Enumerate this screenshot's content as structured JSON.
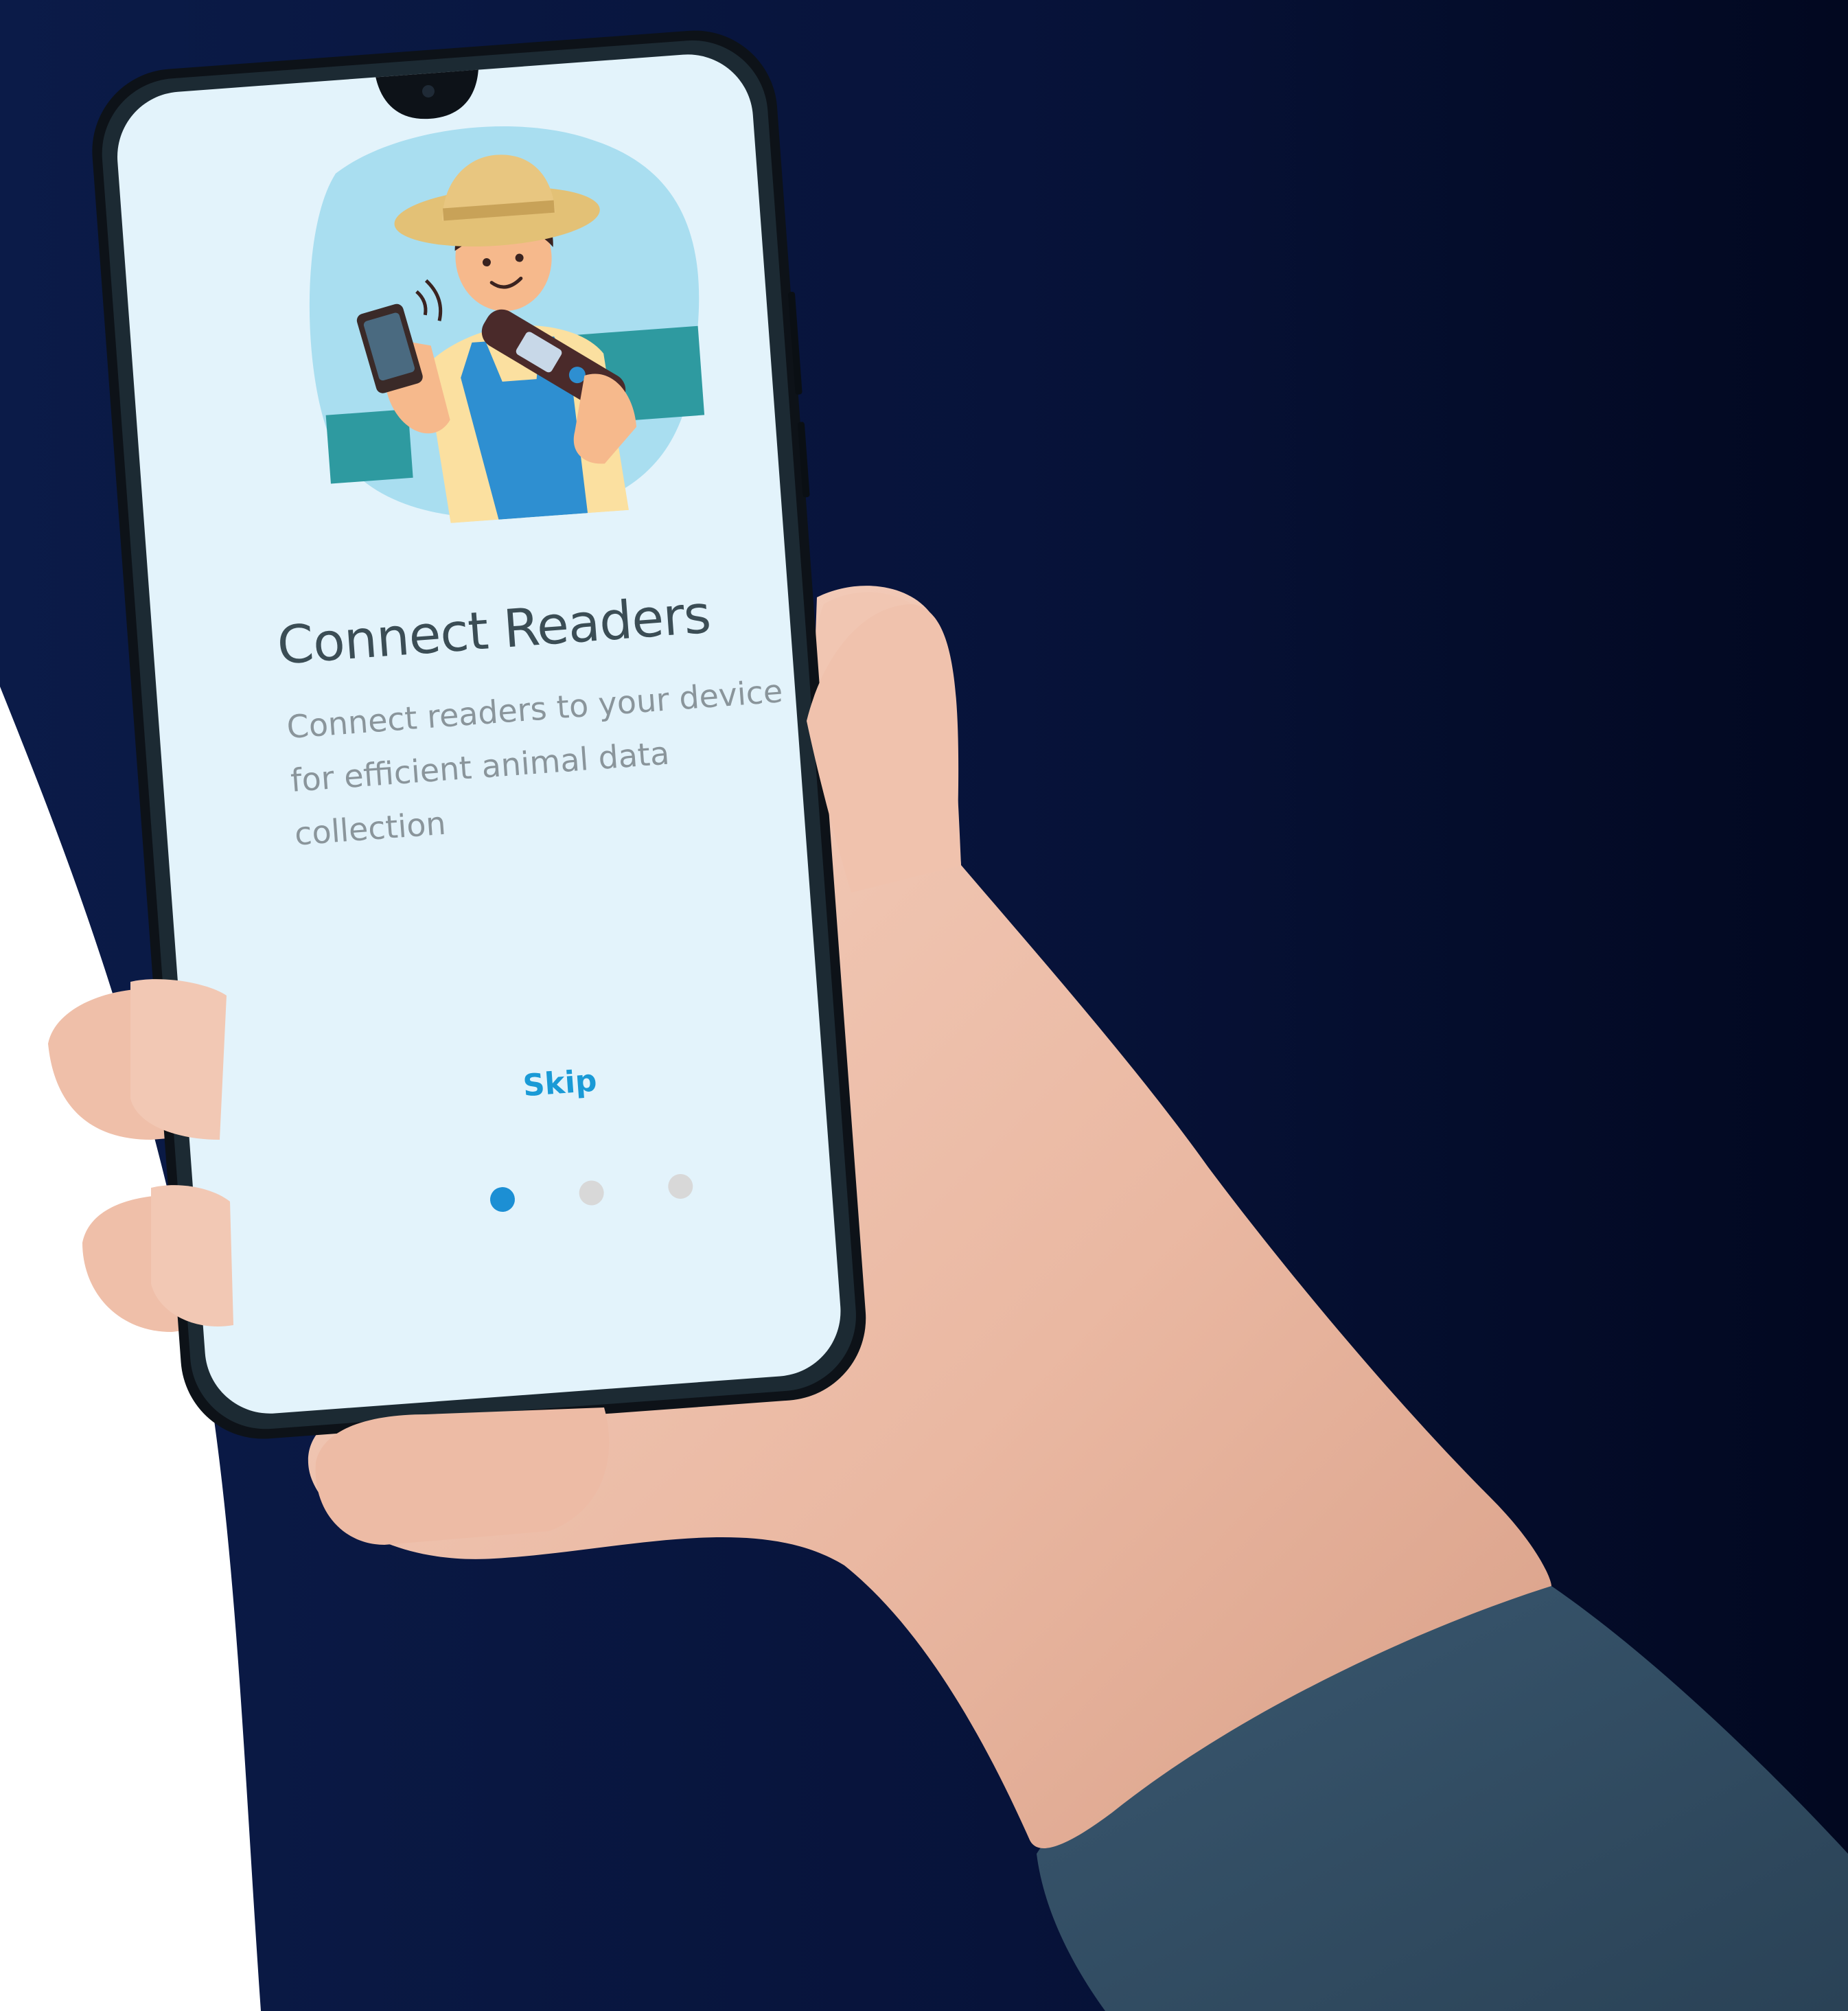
{
  "onboarding": {
    "title": "Connect Readers",
    "description": "Connect readers to your device for efficient animal data collection",
    "skip_label": "Skip",
    "pages_total": 3,
    "active_page": 1,
    "illustration": "farmer-scanning-icon"
  },
  "colors": {
    "background_dark": "#0a1a44",
    "screen_bg": "#e3f3fb",
    "title": "#3b4d55",
    "description": "#8a959b",
    "accent": "#1a9ad6",
    "dot_inactive": "#d8d8d8"
  }
}
